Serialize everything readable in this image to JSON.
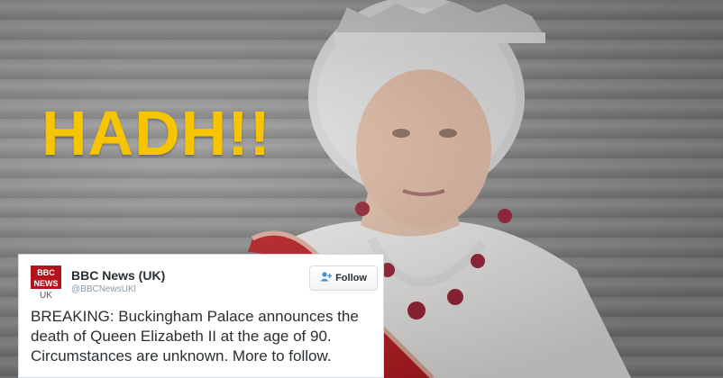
{
  "headline": "HADH!!",
  "tweet": {
    "logo_top": "BBC\nNEWS",
    "logo_sub": "UK",
    "name": "BBC News (UK)",
    "handle": "@BBCNewsUKl",
    "follow_label": "Follow",
    "text": "BREAKING: Buckingham Palace announces the death of Queen Elizabeth II at the age of 90. Circumstances are unknown. More to follow."
  },
  "colors": {
    "headline": "#f7c402",
    "bbc_red": "#b5121b",
    "follow_icon": "#3b94d9"
  },
  "icons": [
    "add-user-icon"
  ]
}
